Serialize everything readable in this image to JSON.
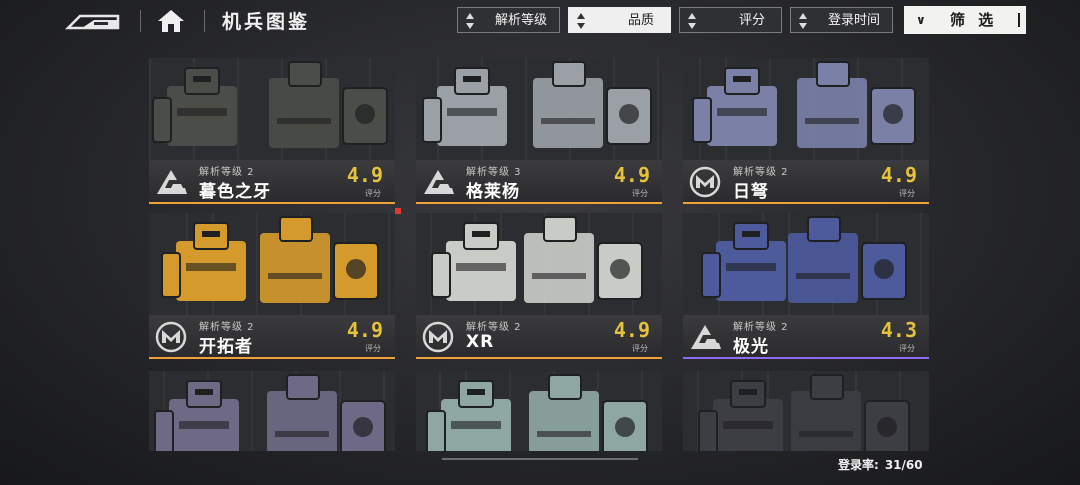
{
  "header": {
    "title": "机兵图鉴",
    "sort_buttons": [
      {
        "label": "解析等级",
        "active": false
      },
      {
        "label": "品质",
        "active": true
      },
      {
        "label": "评分",
        "active": false
      },
      {
        "label": "登录时间",
        "active": false
      }
    ],
    "filter_label": "筛 选"
  },
  "cards": [
    {
      "level": "解析等级 2",
      "name": "暮色之牙",
      "score": "4.9",
      "score_label": "评分",
      "faction": "triangle-emblem-icon",
      "accent": "#f0a23a",
      "body_color": "#4a4d48"
    },
    {
      "level": "解析等级 3",
      "name": "格莱杨",
      "score": "4.9",
      "score_label": "评分",
      "faction": "triangle-emblem-icon",
      "accent": "#f0a23a",
      "body_color": "#9aa0a6"
    },
    {
      "level": "解析等级 2",
      "name": "日弩",
      "score": "4.9",
      "score_label": "评分",
      "faction": "m-emblem-icon",
      "accent": "#f0a23a",
      "body_color": "#7a80a6"
    },
    {
      "level": "解析等级 2",
      "name": "开拓者",
      "score": "4.9",
      "score_label": "评分",
      "faction": "m-emblem-icon",
      "accent": "#f0a23a",
      "body_color": "#d49a2c"
    },
    {
      "level": "解析等级 2",
      "name": "XR",
      "score": "4.9",
      "score_label": "评分",
      "faction": "m-emblem-icon",
      "accent": "#f0a23a",
      "body_color": "#c9cbc6"
    },
    {
      "level": "解析等级 2",
      "name": "极光",
      "score": "4.3",
      "score_label": "评分",
      "faction": "triangle-emblem-icon",
      "accent": "#8c6cf0",
      "body_color": "#4d5a9c"
    }
  ],
  "partial_cards": [
    {
      "body_color": "#6e6a86"
    },
    {
      "body_color": "#8fa7a2"
    },
    {
      "body_color": "#3c3e44"
    }
  ],
  "footer": {
    "rate_label": "登录率:",
    "rate_value": "31/60"
  },
  "colors": {
    "score": "#e4c23b",
    "accent_orange": "#f0a23a",
    "accent_purple": "#8c6cf0"
  }
}
